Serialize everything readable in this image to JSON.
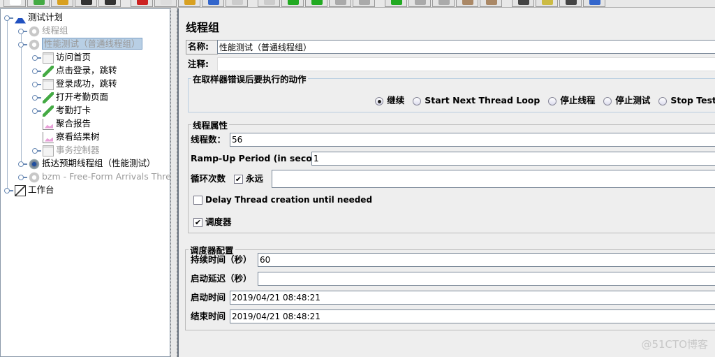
{
  "toolbar": {
    "buttons": [
      "new",
      "templates",
      "open",
      "save",
      "save-as",
      "cut",
      "copy",
      "paste",
      "expand",
      "collapse",
      "toggle",
      "start",
      "start-no-pause",
      "stop",
      "shutdown",
      "remote-start",
      "remote-stop",
      "remote-shutdown",
      "clear",
      "clear-all",
      "search",
      "reset-search",
      "function-helper",
      "help"
    ]
  },
  "tree": {
    "items": [
      {
        "label": "测试计划",
        "icon": "test-plan-flask-icon",
        "level": 0,
        "disabled": false
      },
      {
        "label": "线程组",
        "icon": "thread-group-gear-icon",
        "level": 1,
        "disabled": true
      },
      {
        "label": "性能测试（普通线程组）",
        "icon": "thread-group-gear-icon",
        "level": 1,
        "disabled": true,
        "selected": true
      },
      {
        "label": "访问首页",
        "icon": "http-sampler-icon",
        "level": 2,
        "disabled": false
      },
      {
        "label": "点击登录，跳转",
        "icon": "dropper-icon",
        "level": 2,
        "disabled": false
      },
      {
        "label": "登录成功，跳转",
        "icon": "http-sampler-icon",
        "level": 2,
        "disabled": false
      },
      {
        "label": "打开考勤页面",
        "icon": "dropper-icon",
        "level": 2,
        "disabled": false
      },
      {
        "label": "考勤打卡",
        "icon": "dropper-icon",
        "level": 2,
        "disabled": false
      },
      {
        "label": "聚合报告",
        "icon": "graph-listener-icon",
        "level": 2,
        "disabled": false
      },
      {
        "label": "察看结果树",
        "icon": "graph-listener-icon",
        "level": 2,
        "disabled": false
      },
      {
        "label": "事务控制器",
        "icon": "transaction-controller-icon",
        "level": 2,
        "disabled": true
      },
      {
        "label": "抵达预期线程组（性能测试）",
        "icon": "thread-group-gear-icon",
        "level": 1,
        "disabled": false
      },
      {
        "label": "bzm - Free-Form Arrivals Thread",
        "icon": "thread-group-gear-icon",
        "level": 1,
        "disabled": true
      },
      {
        "label": "工作台",
        "icon": "workbench-icon",
        "level": 0,
        "disabled": false
      }
    ]
  },
  "main": {
    "title": "线程组",
    "name_label": "名称:",
    "name_value": "性能测试（普通线程组）",
    "comment_label": "注释:",
    "comment_value": "",
    "error_group": {
      "title": "在取样器错误后要执行的动作",
      "options": [
        {
          "label": "继续",
          "selected": true
        },
        {
          "label": "Start Next Thread Loop",
          "selected": false
        },
        {
          "label": "停止线程",
          "selected": false
        },
        {
          "label": "停止测试",
          "selected": false
        },
        {
          "label": "Stop Test",
          "selected": false
        }
      ]
    },
    "thread_props": {
      "title": "线程属性",
      "threads_label": "线程数：",
      "threads_value": "56",
      "rampup_label": "Ramp-Up Period (in seconds):",
      "rampup_value": "1",
      "loop_label": "循环次数",
      "forever_label": "永远",
      "forever_checked": true,
      "loop_value": "",
      "delay_label": "Delay Thread creation until needed",
      "delay_checked": false,
      "scheduler_label": "调度器",
      "scheduler_checked": true
    },
    "scheduler": {
      "title": "调度器配置",
      "duration_label": "持续时间（秒）",
      "duration_value": "60",
      "startup_delay_label": "启动延迟（秒）",
      "startup_delay_value": "",
      "start_time_label": "启动时间",
      "start_time_value": "2019/04/21 08:48:21",
      "end_time_label": "结束时间",
      "end_time_value": "2019/04/21 08:48:21"
    }
  },
  "watermark": "@51CTO博客"
}
